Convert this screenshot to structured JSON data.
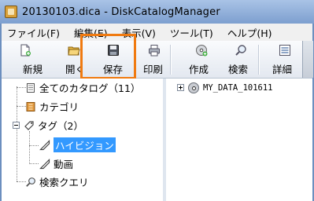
{
  "window": {
    "title": "20130103.dica - DiskCatalogManager"
  },
  "menu": [
    "ファイル(F)",
    "編集(E)",
    "表示(V)",
    "ツール(T)",
    "ヘルプ(H)"
  ],
  "toolbar": {
    "new_label": "新規",
    "open_label": "開く",
    "save_label": "保存",
    "print_label": "印刷",
    "create_label": "作成",
    "search_label": "検索",
    "details_label": "詳細"
  },
  "tree": {
    "all_catalogs": "全てのカタログ（11）",
    "categories": "カテゴリ",
    "tags": "タグ（2）",
    "tag_hivision": "ハイビジョン",
    "tag_video": "動画",
    "search_queries": "検索クエリ"
  },
  "catalog_list": {
    "item_1": "MY_DATA_101611"
  },
  "colors": {
    "highlight_border": "#f07a10",
    "selection": "#3399ff"
  }
}
